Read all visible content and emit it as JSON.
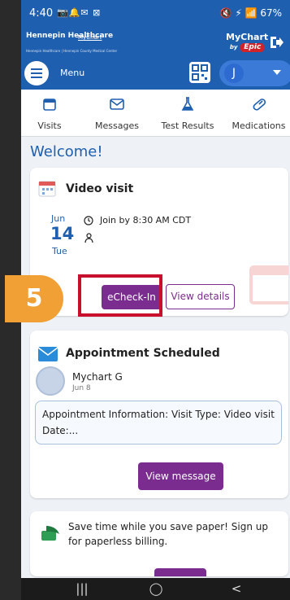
{
  "status_bar": {
    "time": "4:40",
    "left_icons": "📷🔔✉ ⊠",
    "right_icons": "🔇 ⚡ 📶 67%",
    "battery": "67%"
  },
  "brand": {
    "org_name": "Hennepin Healthcare",
    "org_sub": "MyChart",
    "tagline": "Hennepin Healthcare | Hennepin County Medical Center",
    "app_name": "MyChart",
    "app_by": "by",
    "vendor": "Epic"
  },
  "menu": {
    "label": "Menu",
    "user_initial": "J"
  },
  "nav_tabs": [
    {
      "label": "Visits",
      "icon": "calendar-icon"
    },
    {
      "label": "Messages",
      "icon": "envelope-icon"
    },
    {
      "label": "Test Results",
      "icon": "flask-icon"
    },
    {
      "label": "Medications",
      "icon": "pill-icon"
    }
  ],
  "welcome": "Welcome!",
  "video_visit": {
    "title": "Video visit",
    "month": "Jun",
    "day": "14",
    "weekday": "Tue",
    "join_by": "Join by 8:30 AM CDT",
    "echeckin_label": "eCheck-In",
    "view_details_label": "View details"
  },
  "step_badge": "5",
  "appointment": {
    "title": "Appointment Scheduled",
    "sender": "Mychart G",
    "date": "Jun 8",
    "preview": "Appointment Information: Visit Type: Video visit Date:...",
    "view_message_label": "View message"
  },
  "billing": {
    "text": "Save time while you save paper! Sign up for paperless billing."
  },
  "android_nav": {
    "recents": "|||",
    "home": "◯",
    "back": "<"
  },
  "colors": {
    "brand_blue": "#1f5fb0",
    "action_purple": "#7a2d8f",
    "highlight_red": "#c8102e",
    "step_orange": "#f0a035"
  }
}
